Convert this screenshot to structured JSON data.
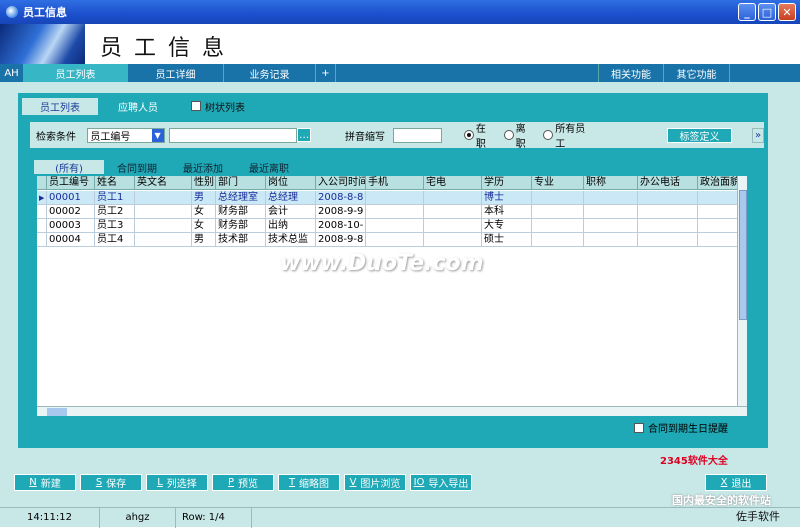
{
  "window": {
    "title": "员工信息"
  },
  "banner": {
    "heading": "员工信息"
  },
  "topnav": {
    "items": [
      {
        "label": "AH"
      },
      {
        "label": "员工列表"
      },
      {
        "label": "员工详细"
      },
      {
        "label": "业务记录"
      },
      {
        "label": "+"
      }
    ],
    "right": [
      {
        "label": "相关功能"
      },
      {
        "label": "其它功能"
      }
    ]
  },
  "subtabs": {
    "items": [
      {
        "label": "员工列表"
      },
      {
        "label": "应聘人员"
      }
    ],
    "tree_label": "树状列表"
  },
  "search": {
    "condition_label": "检索条件",
    "field_value": "员工编号",
    "pinyin_label": "拼音缩写",
    "status_options": [
      "在职",
      "离职",
      "所有员工"
    ],
    "tag_button": "标签定义"
  },
  "grid": {
    "tabs": [
      "(所有)",
      "合同到期",
      "最近添加",
      "最近离职"
    ],
    "columns": [
      "员工编号",
      "姓名",
      "英文名",
      "性别",
      "部门",
      "岗位",
      "入公司时间",
      "手机",
      "宅电",
      "学历",
      "专业",
      "职称",
      "办公电话",
      "政治面貌"
    ],
    "rows": [
      [
        "00001",
        "员工1",
        "",
        "男",
        "总经理室",
        "总经理",
        "2008-8-8",
        "",
        "",
        "博士",
        "",
        "",
        "",
        ""
      ],
      [
        "00002",
        "员工2",
        "",
        "女",
        "财务部",
        "会计",
        "2008-9-9",
        "",
        "",
        "本科",
        "",
        "",
        "",
        ""
      ],
      [
        "00003",
        "员工3",
        "",
        "女",
        "财务部",
        "出纳",
        "2008-10-",
        "",
        "",
        "大专",
        "",
        "",
        "",
        ""
      ],
      [
        "00004",
        "员工4",
        "",
        "男",
        "技术部",
        "技术总监",
        "2008-9-8",
        "",
        "",
        "硕士",
        "",
        "",
        "",
        ""
      ]
    ],
    "footer_check": "合同到期生日提醒"
  },
  "bottom_buttons": [
    {
      "key": "N",
      "label": "新建"
    },
    {
      "key": "S",
      "label": "保存"
    },
    {
      "key": "L",
      "label": "列选择"
    },
    {
      "key": "P",
      "label": "预览"
    },
    {
      "key": "T",
      "label": "缩略图"
    },
    {
      "key": "V",
      "label": "图片浏览"
    },
    {
      "key": "IO",
      "label": "导入导出"
    }
  ],
  "exit_button": {
    "key": "X",
    "label": "退出"
  },
  "status": {
    "time": "14:11:12",
    "user": "ahgz",
    "row": "Row: 1/4"
  },
  "watermark": "www.DuoTe.com",
  "logos": {
    "brand_2345": "2345软件大全",
    "brand_cn": "国内最安全的软件站",
    "brand": "佐手软件"
  }
}
